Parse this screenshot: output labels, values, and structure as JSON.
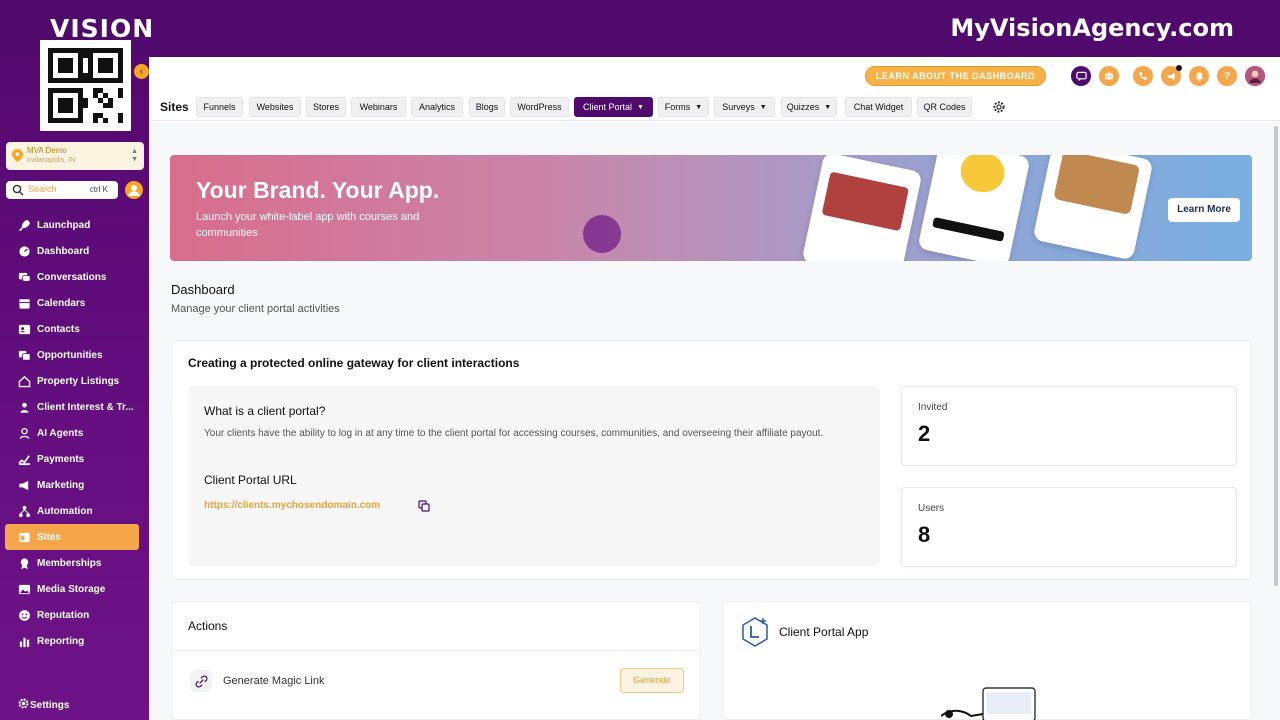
{
  "brand": {
    "logo_text": "VISION",
    "site_domain": "MyVisionAgency.com"
  },
  "colors": {
    "primary": "#4f0a6b",
    "accent": "#f5a54a",
    "link": "#e8a33b"
  },
  "sidebar": {
    "account": {
      "name": "MVA Demo",
      "location": "Indianapolis, IN"
    },
    "search": {
      "placeholder": "Search",
      "shortcut": "ctrl K"
    },
    "items": [
      {
        "label": "Launchpad",
        "icon": "rocket-icon"
      },
      {
        "label": "Dashboard",
        "icon": "gauge-icon"
      },
      {
        "label": "Conversations",
        "icon": "chat-icon"
      },
      {
        "label": "Calendars",
        "icon": "calendar-icon"
      },
      {
        "label": "Contacts",
        "icon": "contacts-icon"
      },
      {
        "label": "Opportunities",
        "icon": "filter-icon"
      },
      {
        "label": "Property Listings",
        "icon": "home-icon"
      },
      {
        "label": "Client Interest & Tr...",
        "icon": "person-icon"
      },
      {
        "label": "AI Agents",
        "icon": "robot-icon"
      },
      {
        "label": "Payments",
        "icon": "payments-icon"
      },
      {
        "label": "Marketing",
        "icon": "megaphone-icon"
      },
      {
        "label": "Automation",
        "icon": "automation-icon"
      },
      {
        "label": "Sites",
        "icon": "sites-icon",
        "active": true
      },
      {
        "label": "Memberships",
        "icon": "badge-icon"
      },
      {
        "label": "Media Storage",
        "icon": "image-icon"
      },
      {
        "label": "Reputation",
        "icon": "smile-icon"
      },
      {
        "label": "Reporting",
        "icon": "bar-chart-icon"
      }
    ],
    "settings_label": "Settings"
  },
  "header": {
    "learn_button": "LEARN ABOUT THE DASHBOARD"
  },
  "tabs": {
    "title": "Sites",
    "items": [
      {
        "label": "Funnels"
      },
      {
        "label": "Websites"
      },
      {
        "label": "Stores"
      },
      {
        "label": "Webinars"
      },
      {
        "label": "Analytics"
      },
      {
        "label": "Blogs"
      },
      {
        "label": "WordPress"
      },
      {
        "label": "Client Portal",
        "active": true,
        "dropdown": true
      },
      {
        "label": "Forms",
        "dropdown": true
      },
      {
        "label": "Surveys",
        "dropdown": true
      },
      {
        "label": "Quizzes",
        "dropdown": true
      },
      {
        "label": "Chat Widget"
      },
      {
        "label": "QR Codes"
      }
    ]
  },
  "banner": {
    "title": "Your Brand. Your App.",
    "subtitle": "Launch your white-label app with courses and communities",
    "button": "Learn More"
  },
  "page": {
    "title": "Dashboard",
    "subtitle": "Manage your client portal activities"
  },
  "gateway": {
    "title": "Creating a protected online gateway for client interactions",
    "what_title": "What is a client portal?",
    "what_desc": "Your clients have the ability to log in at any time to the client portal for accessing courses, communities, and overseeing their affiliate payout.",
    "url_label": "Client Portal URL",
    "url": "https://clients.mychosendomain.com"
  },
  "stats": {
    "invited": {
      "label": "Invited",
      "value": "2"
    },
    "users": {
      "label": "Users",
      "value": "8"
    }
  },
  "actions": {
    "title": "Actions",
    "magic_link_label": "Generate Magic Link",
    "generate_button": "Generate"
  },
  "app": {
    "title": "Client Portal App"
  }
}
